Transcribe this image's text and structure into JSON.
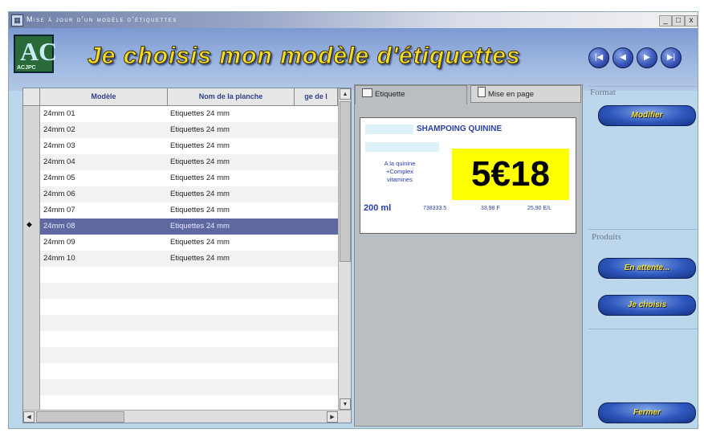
{
  "window": {
    "title": "Mise à jour d'un modèle d'étiquettes",
    "controls": [
      "_",
      "□",
      "x"
    ]
  },
  "header": {
    "logo_mark": "AC",
    "logo_text": "ACJPC",
    "title": "Je choisis mon modèle d'étiquettes",
    "nav_buttons": [
      "|◀",
      "◀",
      "▶",
      "▶|"
    ]
  },
  "grid": {
    "columns": [
      "Modèle",
      "Nom de la planche",
      "ge de l"
    ],
    "selected_index": 7,
    "rows": [
      {
        "model": "24mm 01",
        "sheet": "Etiquettes 24 mm"
      },
      {
        "model": "24mm 02",
        "sheet": "Etiquettes 24 mm"
      },
      {
        "model": "24mm 03",
        "sheet": "Etiquettes 24 mm"
      },
      {
        "model": "24mm 04",
        "sheet": "Etiquettes 24 mm"
      },
      {
        "model": "24mm 05",
        "sheet": "Etiquettes 24 mm"
      },
      {
        "model": "24mm 06",
        "sheet": "Etiquettes 24 mm"
      },
      {
        "model": "24mm 07",
        "sheet": "Etiquettes 24 mm"
      },
      {
        "model": "24mm 08",
        "sheet": "Etiquettes 24 mm"
      },
      {
        "model": "24mm 09",
        "sheet": "Etiquettes 24 mm"
      },
      {
        "model": "24mm 10",
        "sheet": "Etiquettes 24 mm"
      }
    ],
    "selected_marker": "◆"
  },
  "tabs": {
    "etiquette": "Etiquette",
    "mise_en_page": "Mise en page"
  },
  "label_preview": {
    "product": "SHAMPOING QUININE",
    "note": [
      "A la quinine",
      "+Complex",
      "vitamines"
    ],
    "price": "5€18",
    "volume": "200 ml",
    "code": "738333.5",
    "franc_price": "33,98 F",
    "unit_price": "25,90 E/L"
  },
  "side": {
    "format_label": "Format",
    "modify_button": "Modifier",
    "products_label": "Produits",
    "waiting_button": "En attente...",
    "choose_button": "Je choisis",
    "close_button": "Fermer"
  },
  "colors": {
    "title_yellow": "#f5dc2a",
    "button_blue": "#2f58be",
    "selection": "#5f68a0",
    "price_background": "#ffff00"
  }
}
